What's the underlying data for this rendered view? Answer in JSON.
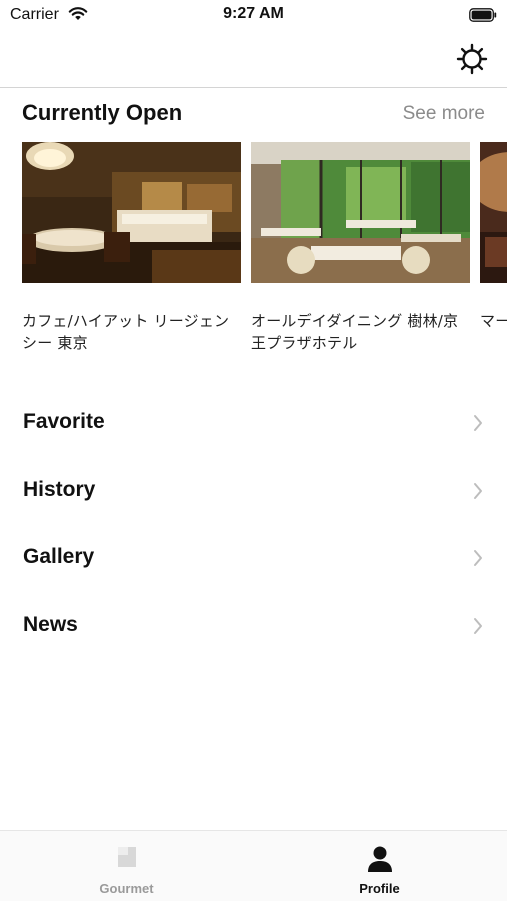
{
  "status_bar": {
    "carrier": "Carrier",
    "time": "9:27 AM"
  },
  "nav": {
    "settings_icon": "gear-icon"
  },
  "currently_open": {
    "title": "Currently Open",
    "see_more": "See more",
    "cards": [
      {
        "caption": "カフェ/ハイアット リージェンシー 東京"
      },
      {
        "caption": "オールデイダイニング 樹林/京王プラザホテル"
      },
      {
        "caption": "マーン東"
      }
    ]
  },
  "menu": {
    "items": [
      {
        "label": "Favorite"
      },
      {
        "label": "History"
      },
      {
        "label": "Gallery"
      },
      {
        "label": "News"
      }
    ]
  },
  "tab_bar": {
    "tabs": [
      {
        "label": "Gourmet",
        "icon": "gourmet-icon",
        "active": false
      },
      {
        "label": "Profile",
        "icon": "profile-icon",
        "active": true
      }
    ],
    "active_color": "#111111",
    "inactive_color": "#9a9a9a"
  }
}
